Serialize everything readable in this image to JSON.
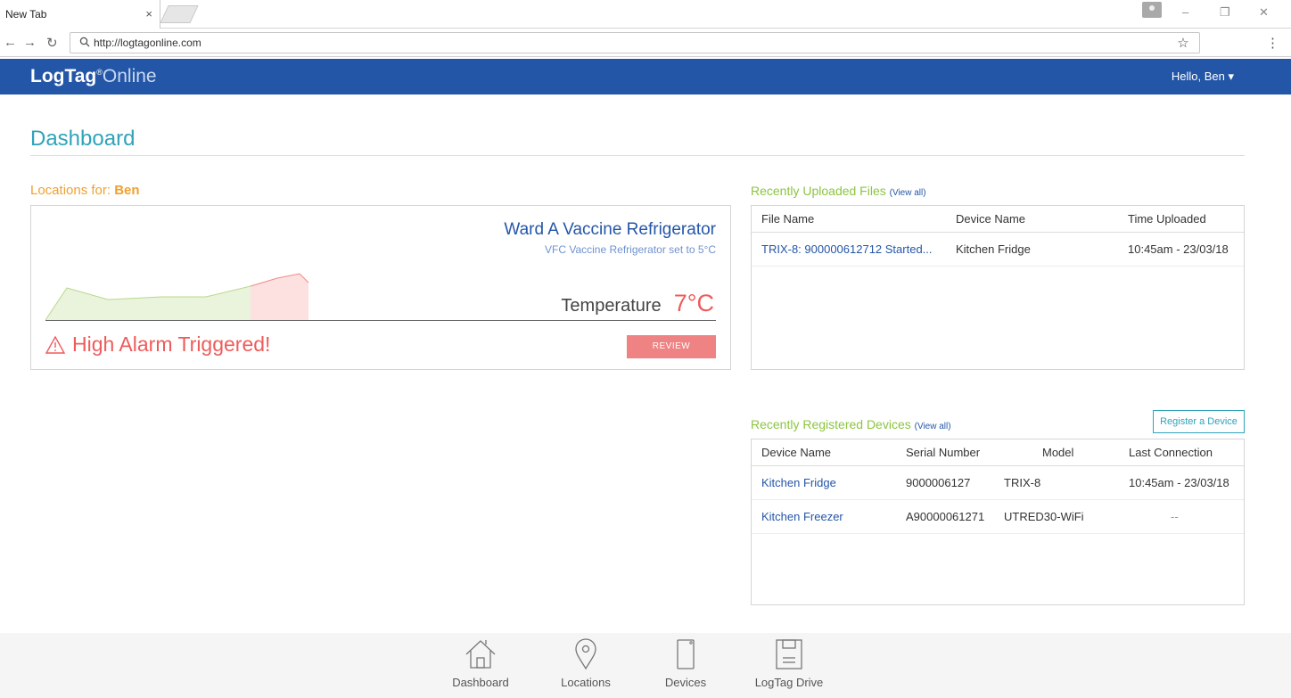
{
  "browser": {
    "tab_title": "New Tab",
    "tab_close": "×",
    "url": "http://logtagonline.com",
    "controls": {
      "minimize": "–",
      "restore": "❐",
      "close": "✕"
    }
  },
  "header": {
    "logo_bold": "LogTag",
    "logo_reg": "®",
    "logo_light": "Online",
    "user_menu": "Hello, Ben  ▾"
  },
  "page": {
    "title": "Dashboard"
  },
  "locations": {
    "label_prefix": "Locations for: ",
    "user": "Ben",
    "card": {
      "name": "Ward A Vaccine Refrigerator",
      "subtitle": "VFC Vaccine Refrigerator set to 5°C",
      "temperature_label": "Temperature",
      "temperature_value": "7°C",
      "alarm_text": "High Alarm Triggered!",
      "review_label": "REVIEW"
    }
  },
  "files": {
    "title": "Recently Uploaded Files",
    "view_all": "(View all)",
    "columns": [
      "File Name",
      "Device Name",
      "Time Uploaded"
    ],
    "rows": [
      {
        "file": "TRIX-8: 900000612712 Started...",
        "device": "Kitchen Fridge",
        "time": "10:45am - 23/03/18"
      }
    ]
  },
  "devices": {
    "title": "Recently Registered Devices",
    "view_all": "(View all)",
    "register_label": "Register a Device",
    "columns": [
      "Device Name",
      "Serial Number",
      "Model",
      "Last Connection"
    ],
    "rows": [
      {
        "name": "Kitchen Fridge",
        "serial": "9000006127",
        "model": "TRIX-8",
        "last": "10:45am - 23/03/18"
      },
      {
        "name": "Kitchen Freezer",
        "serial": "A90000061271",
        "model": "UTRED30-WiFi",
        "last": "--"
      }
    ]
  },
  "bottom_nav": {
    "items": [
      "Dashboard",
      "Locations",
      "Devices",
      "LogTag Drive"
    ]
  },
  "colors": {
    "header_blue": "#2456a7",
    "teal": "#2fa3ba",
    "green": "#8cc540",
    "orange": "#f0a030",
    "alarm_red": "#ef5b5b"
  }
}
